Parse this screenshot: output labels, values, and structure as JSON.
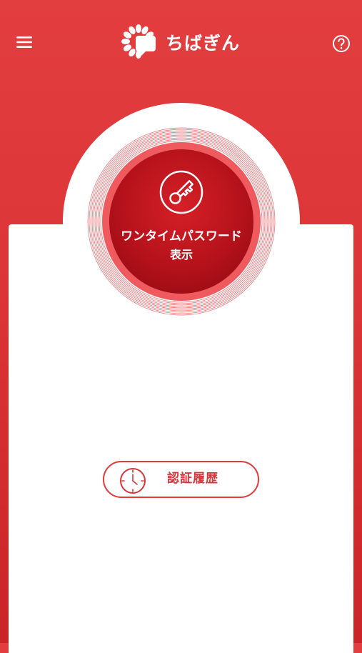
{
  "header": {
    "logo_text": "ちばぎん",
    "menu_icon": "hamburger-menu-icon",
    "help_icon": "question-circle-icon"
  },
  "otp": {
    "label_line1": "ワンタイムパスワード",
    "label_line2": "表示",
    "icon": "key-icon"
  },
  "history": {
    "label": "認証履歴",
    "icon": "clock-icon"
  },
  "colors": {
    "brand_red": "#e23d3f",
    "button_red": "#c0131a",
    "white": "#ffffff"
  }
}
